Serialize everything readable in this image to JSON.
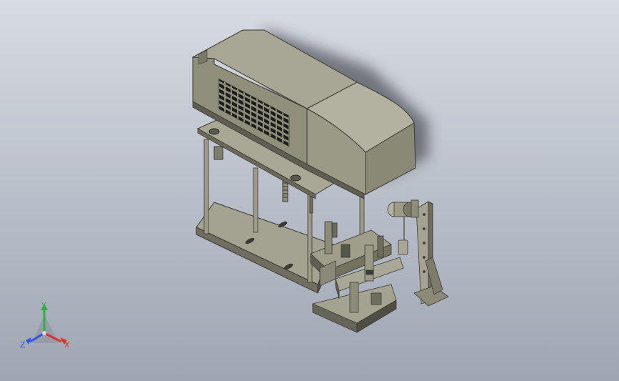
{
  "viewport": {
    "background_top": "#d7dbe2",
    "background_bottom": "#9ea6b3"
  },
  "model": {
    "body_color": "#8f8d7a",
    "dark_color": "#3f3e36",
    "light_color": "#b9b8a8"
  },
  "triad": {
    "x_label": "X",
    "y_label": "Y",
    "z_label": "Z",
    "x_color": "#e0322b",
    "y_color": "#2fb043",
    "z_color": "#2f56d4"
  }
}
